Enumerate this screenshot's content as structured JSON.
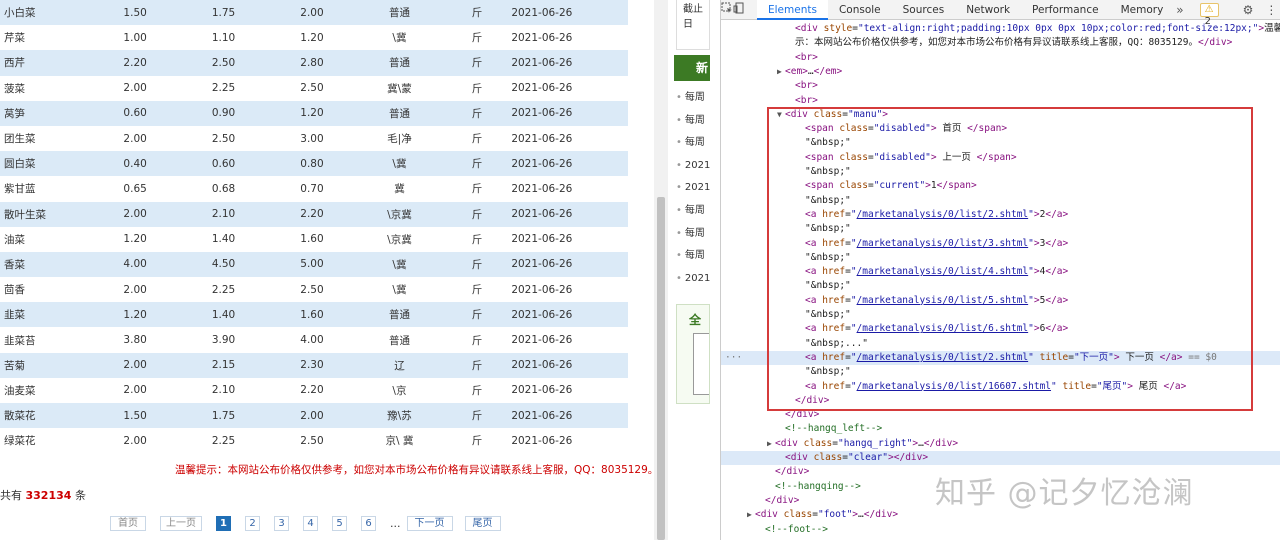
{
  "price_table": {
    "rows": [
      {
        "name": "小白菜",
        "low": "1.50",
        "avg": "1.75",
        "high": "2.00",
        "origin": "普通",
        "unit": "斤",
        "date": "2021-06-26"
      },
      {
        "name": "芹菜",
        "low": "1.00",
        "avg": "1.10",
        "high": "1.20",
        "origin": "\\冀",
        "unit": "斤",
        "date": "2021-06-26"
      },
      {
        "name": "西芹",
        "low": "2.20",
        "avg": "2.50",
        "high": "2.80",
        "origin": "普通",
        "unit": "斤",
        "date": "2021-06-26"
      },
      {
        "name": "菠菜",
        "low": "2.00",
        "avg": "2.25",
        "high": "2.50",
        "origin": "冀\\蒙",
        "unit": "斤",
        "date": "2021-06-26"
      },
      {
        "name": "莴笋",
        "low": "0.60",
        "avg": "0.90",
        "high": "1.20",
        "origin": "普通",
        "unit": "斤",
        "date": "2021-06-26"
      },
      {
        "name": "团生菜",
        "low": "2.00",
        "avg": "2.50",
        "high": "3.00",
        "origin": "毛|净",
        "unit": "斤",
        "date": "2021-06-26"
      },
      {
        "name": "圆白菜",
        "low": "0.40",
        "avg": "0.60",
        "high": "0.80",
        "origin": "\\冀",
        "unit": "斤",
        "date": "2021-06-26"
      },
      {
        "name": "紫甘蓝",
        "low": "0.65",
        "avg": "0.68",
        "high": "0.70",
        "origin": "冀",
        "unit": "斤",
        "date": "2021-06-26"
      },
      {
        "name": "散叶生菜",
        "low": "2.00",
        "avg": "2.10",
        "high": "2.20",
        "origin": "\\京冀",
        "unit": "斤",
        "date": "2021-06-26"
      },
      {
        "name": "油菜",
        "low": "1.20",
        "avg": "1.40",
        "high": "1.60",
        "origin": "\\京冀",
        "unit": "斤",
        "date": "2021-06-26"
      },
      {
        "name": "香菜",
        "low": "4.00",
        "avg": "4.50",
        "high": "5.00",
        "origin": "\\冀",
        "unit": "斤",
        "date": "2021-06-26"
      },
      {
        "name": "茴香",
        "low": "2.00",
        "avg": "2.25",
        "high": "2.50",
        "origin": "\\冀",
        "unit": "斤",
        "date": "2021-06-26"
      },
      {
        "name": "韭菜",
        "low": "1.20",
        "avg": "1.40",
        "high": "1.60",
        "origin": "普通",
        "unit": "斤",
        "date": "2021-06-26"
      },
      {
        "name": "韭菜苔",
        "low": "3.80",
        "avg": "3.90",
        "high": "4.00",
        "origin": "普通",
        "unit": "斤",
        "date": "2021-06-26"
      },
      {
        "name": "苦菊",
        "low": "2.00",
        "avg": "2.15",
        "high": "2.30",
        "origin": "辽",
        "unit": "斤",
        "date": "2021-06-26"
      },
      {
        "name": "油麦菜",
        "low": "2.00",
        "avg": "2.10",
        "high": "2.20",
        "origin": "\\京",
        "unit": "斤",
        "date": "2021-06-26"
      },
      {
        "name": "散菜花",
        "low": "1.50",
        "avg": "1.75",
        "high": "2.00",
        "origin": "豫\\苏",
        "unit": "斤",
        "date": "2021-06-26"
      },
      {
        "name": "绿菜花",
        "low": "2.00",
        "avg": "2.25",
        "high": "2.50",
        "origin": "京\\ 冀",
        "unit": "斤",
        "date": "2021-06-26"
      }
    ],
    "tip": "温馨提示：本网站公布价格仅供参考，如您对本市场公布价格有异议请联系线上客服，QQ：8035129。",
    "total_prefix": "共有",
    "total_count": "332134",
    "total_suffix": "条",
    "pager": {
      "first": "首页",
      "prev": "上一页",
      "pages": [
        "1",
        "2",
        "3",
        "4",
        "5",
        "6"
      ],
      "current": "1",
      "ellipsis": "...",
      "next": "下一页",
      "last": "尾页"
    }
  },
  "middle": {
    "deadline_text": "截止日",
    "news_title": "新",
    "news_items": [
      "每周",
      "每周",
      "每周",
      "2021",
      "2021",
      "每周",
      "每周",
      "每周",
      "2021"
    ],
    "all_box_title": "全"
  },
  "devtools": {
    "tabs": [
      "Elements",
      "Console",
      "Sources",
      "Network",
      "Performance",
      "Memory"
    ],
    "active_tab": "Elements",
    "more": "»",
    "warning_count": "2",
    "lines": [
      {
        "indent": 66,
        "html": "<span class=\"tg\">&lt;div</span> <span class=\"an\">style</span>=<span class=\"av\">\"text-align:right;padding:10px 0px 0px 10px;color:red;font-size:12px;\"</span><span class=\"tg\">&gt;</span>温馨提"
      },
      {
        "indent": 66,
        "html": "示：本网站公布价格仅供参考，如您对本市场公布价格有异议请联系线上客服，QQ：8035129。<span class=\"tg\">&lt;/div&gt;</span>"
      },
      {
        "indent": 66,
        "html": "<span class=\"tg\">&lt;br&gt;</span>"
      },
      {
        "indent": 56,
        "arrow": "▶",
        "html": "<span class=\"tg\">&lt;em&gt;</span>…<span class=\"tg\">&lt;/em&gt;</span>"
      },
      {
        "indent": 66,
        "html": "<span class=\"tg\">&lt;br&gt;</span>"
      },
      {
        "indent": 66,
        "html": "<span class=\"tg\">&lt;br&gt;</span>"
      },
      {
        "indent": 56,
        "arrow": "▼",
        "html": "<span class=\"tg\">&lt;div</span> <span class=\"an\">class</span>=<span class=\"av\">\"manu\"</span><span class=\"tg\">&gt;</span>"
      },
      {
        "indent": 76,
        "html": "<span class=\"tg\">&lt;span</span> <span class=\"an\">class</span>=<span class=\"av\">\"disabled\"</span><span class=\"tg\">&gt;</span> 首页 <span class=\"tg\">&lt;/span&gt;</span>"
      },
      {
        "indent": 76,
        "html": "<span class=\"str\">\"&amp;nbsp;\"</span>"
      },
      {
        "indent": 76,
        "html": "<span class=\"tg\">&lt;span</span> <span class=\"an\">class</span>=<span class=\"av\">\"disabled\"</span><span class=\"tg\">&gt;</span> 上一页 <span class=\"tg\">&lt;/span&gt;</span>"
      },
      {
        "indent": 76,
        "html": "<span class=\"str\">\"&amp;nbsp;\"</span>"
      },
      {
        "indent": 76,
        "html": "<span class=\"tg\">&lt;span</span> <span class=\"an\">class</span>=<span class=\"av\">\"current\"</span><span class=\"tg\">&gt;</span>1<span class=\"tg\">&lt;/span&gt;</span>"
      },
      {
        "indent": 76,
        "html": "<span class=\"str\">\"&amp;nbsp;\"</span>"
      },
      {
        "indent": 76,
        "html": "<span class=\"tg\">&lt;a</span> <span class=\"an\">href</span>=<span class=\"av\">\"</span><span class=\"av link\">/marketanalysis/0/list/2.shtml</span><span class=\"av\">\"</span><span class=\"tg\">&gt;</span>2<span class=\"tg\">&lt;/a&gt;</span>"
      },
      {
        "indent": 76,
        "html": "<span class=\"str\">\"&amp;nbsp;\"</span>"
      },
      {
        "indent": 76,
        "html": "<span class=\"tg\">&lt;a</span> <span class=\"an\">href</span>=<span class=\"av\">\"</span><span class=\"av link\">/marketanalysis/0/list/3.shtml</span><span class=\"av\">\"</span><span class=\"tg\">&gt;</span>3<span class=\"tg\">&lt;/a&gt;</span>"
      },
      {
        "indent": 76,
        "html": "<span class=\"str\">\"&amp;nbsp;\"</span>"
      },
      {
        "indent": 76,
        "html": "<span class=\"tg\">&lt;a</span> <span class=\"an\">href</span>=<span class=\"av\">\"</span><span class=\"av link\">/marketanalysis/0/list/4.shtml</span><span class=\"av\">\"</span><span class=\"tg\">&gt;</span>4<span class=\"tg\">&lt;/a&gt;</span>"
      },
      {
        "indent": 76,
        "html": "<span class=\"str\">\"&amp;nbsp;\"</span>"
      },
      {
        "indent": 76,
        "html": "<span class=\"tg\">&lt;a</span> <span class=\"an\">href</span>=<span class=\"av\">\"</span><span class=\"av link\">/marketanalysis/0/list/5.shtml</span><span class=\"av\">\"</span><span class=\"tg\">&gt;</span>5<span class=\"tg\">&lt;/a&gt;</span>"
      },
      {
        "indent": 76,
        "html": "<span class=\"str\">\"&amp;nbsp;\"</span>"
      },
      {
        "indent": 76,
        "html": "<span class=\"tg\">&lt;a</span> <span class=\"an\">href</span>=<span class=\"av\">\"</span><span class=\"av link\">/marketanalysis/0/list/6.shtml</span><span class=\"av\">\"</span><span class=\"tg\">&gt;</span>6<span class=\"tg\">&lt;/a&gt;</span>"
      },
      {
        "indent": 76,
        "html": "<span class=\"str\">\"&amp;nbsp;...\"</span>"
      },
      {
        "indent": 76,
        "selected": true,
        "html": "<span class=\"tg\">&lt;a</span> <span class=\"an\">href</span>=<span class=\"av\">\"</span><span class=\"av link\">/marketanalysis/0/list/2.shtml</span><span class=\"av\">\"</span> <span class=\"an\">title</span>=<span class=\"av\">\"下一页\"</span><span class=\"tg\">&gt;</span> 下一页 <span class=\"tg\">&lt;/a&gt;</span> <span class=\"eq\">== $0</span>"
      },
      {
        "indent": 76,
        "html": "<span class=\"str\">\"&amp;nbsp;\"</span>"
      },
      {
        "indent": 76,
        "html": "<span class=\"tg\">&lt;a</span> <span class=\"an\">href</span>=<span class=\"av\">\"</span><span class=\"av link\">/marketanalysis/0/list/16607.shtml</span><span class=\"av\">\"</span> <span class=\"an\">title</span>=<span class=\"av\">\"尾页\"</span><span class=\"tg\">&gt;</span> 尾页 <span class=\"tg\">&lt;/a&gt;</span>"
      },
      {
        "indent": 66,
        "html": "<span class=\"tg\">&lt;/div&gt;</span>"
      },
      {
        "indent": 56,
        "html": "<span class=\"tg\">&lt;/div&gt;</span>"
      },
      {
        "indent": 56,
        "html": "<span class=\"cm\">&lt;!--hangq_left--&gt;</span>"
      },
      {
        "indent": 46,
        "arrow": "▶",
        "html": "<span class=\"tg\">&lt;div</span> <span class=\"an\">class</span>=<span class=\"av\">\"hangq_right\"</span><span class=\"tg\">&gt;</span>…<span class=\"tg\">&lt;/div&gt;</span>"
      },
      {
        "indent": 56,
        "hover": true,
        "html": "<span class=\"tg\">&lt;div</span> <span class=\"an\">class</span>=<span class=\"av\">\"clear\"</span><span class=\"tg\">&gt;</span><span class=\"tg\">&lt;/div&gt;</span>"
      },
      {
        "indent": 46,
        "html": "<span class=\"tg\">&lt;/div&gt;</span>"
      },
      {
        "indent": 46,
        "html": "<span class=\"cm\">&lt;!--hangqing--&gt;</span>"
      },
      {
        "indent": 36,
        "html": "<span class=\"tg\">&lt;/div&gt;</span>"
      },
      {
        "indent": 26,
        "arrow": "▶",
        "html": "<span class=\"tg\">&lt;div</span> <span class=\"an\">class</span>=<span class=\"av\">\"foot\"</span><span class=\"tg\">&gt;</span>…<span class=\"tg\">&lt;/div&gt;</span>"
      },
      {
        "indent": 36,
        "html": "<span class=\"cm\">&lt;!--foot--&gt;</span>"
      }
    ]
  },
  "watermark": "知乎 @记夕忆沧澜"
}
